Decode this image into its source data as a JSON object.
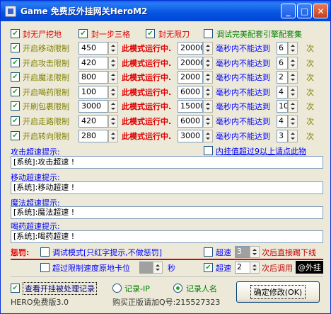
{
  "window": {
    "title": "Game 免费反外挂网关HeroM2",
    "min": "_",
    "max": "□",
    "close": "✕"
  },
  "top_checks": [
    {
      "label": "封无尸挖地",
      "checked": true
    },
    {
      "label": "封一步三格",
      "checked": true
    },
    {
      "label": "封无限刀",
      "checked": true
    },
    {
      "label": "调试完美配套引擎配套集",
      "checked": false
    }
  ],
  "limits": [
    {
      "label": "开启移动限制",
      "checked": true,
      "v1": "450",
      "mode": "此模式运行中.",
      "v2": "20000",
      "per": "毫秒内不能达到",
      "v3": "6",
      "unit": "次"
    },
    {
      "label": "开启攻击限制",
      "checked": true,
      "v1": "420",
      "mode": "此模式运行中.",
      "v2": "20000",
      "per": "毫秒内不能达到",
      "v3": "6",
      "unit": "次"
    },
    {
      "label": "开启魔法限制",
      "checked": true,
      "v1": "800",
      "mode": "此模式运行中.",
      "v2": "2000",
      "per": "毫秒内不能达到",
      "v3": "2",
      "unit": "次"
    },
    {
      "label": "开启喝药限制",
      "checked": true,
      "v1": "100",
      "mode": "此模式运行中.",
      "v2": "6000",
      "per": "毫秒内不能达到",
      "v3": "4",
      "unit": "次"
    },
    {
      "label": "开刷包裹限制",
      "checked": true,
      "v1": "3000",
      "mode": "此模式运行中.",
      "v2": "15000",
      "per": "毫秒内不能达到",
      "v3": "10",
      "unit": "次"
    },
    {
      "label": "开启走路限制",
      "checked": true,
      "v1": "420",
      "mode": "此模式运行中.",
      "v2": "6000",
      "per": "毫秒内不能达到",
      "v3": "4",
      "unit": "次"
    },
    {
      "label": "开启转向限制",
      "checked": true,
      "v1": "280",
      "mode": "此模式运行中.",
      "v2": "3000",
      "per": "毫秒内不能达到",
      "v3": "3",
      "unit": "次"
    }
  ],
  "prompts": {
    "attack_label": "攻击超速提示:",
    "attack_value": "[系统]:攻击超速 !",
    "inner_check_label": "内挂值超过9以上请点此物",
    "move_label": "移动超速提示:",
    "move_value": "[系统]:移动超速 !",
    "magic_label": "魔法超速提示:",
    "magic_value": "[系统]:魔法超速 !",
    "drink_label": "喝药超速提示:",
    "drink_value": "[系统]:喝药超速 !"
  },
  "punish": {
    "label": "惩罚:",
    "debug_label": "调试模式[只红字提示,不做惩罚]",
    "speed1_label": "超速",
    "speed1_value": "3",
    "speed1_after": "次后直接踢下线",
    "stuck_label": "超过限制速度原地卡位",
    "stuck_value": "",
    "stuck_unit": "秒",
    "speed2_label": "超速",
    "speed2_value": "2",
    "speed2_after": "次后调用",
    "speed2_target": "@外挂"
  },
  "bottom": {
    "view_log_label": "查看开挂被处理记录",
    "radio_ip": "记录-IP",
    "radio_name": "记录人名",
    "ok_button": "确定修改(OK)",
    "version": "HERO免费版3.0",
    "purchase": "购买正版请加Q号:215527323"
  }
}
